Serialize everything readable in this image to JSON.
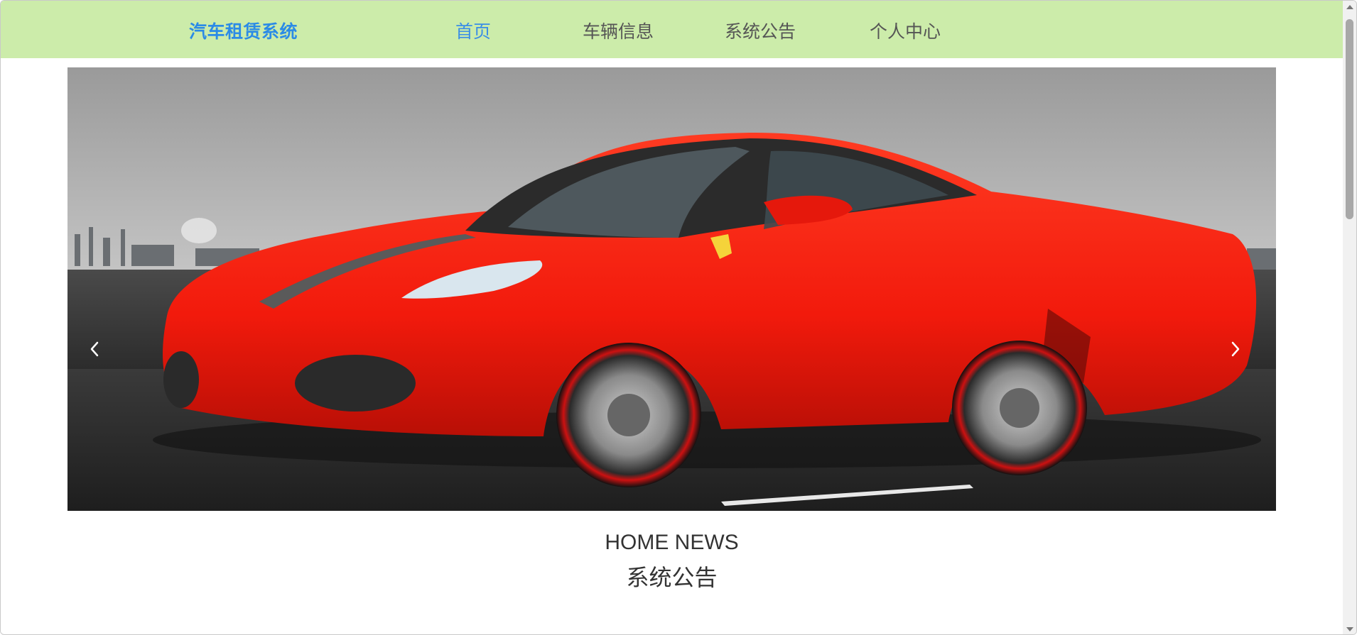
{
  "header": {
    "brand": "汽车租赁系统",
    "nav": [
      {
        "label": "首页",
        "active": true
      },
      {
        "label": "车辆信息",
        "active": false
      },
      {
        "label": "系统公告",
        "active": false
      },
      {
        "label": "个人中心",
        "active": false
      }
    ]
  },
  "carousel": {
    "slide_count": 3,
    "active_index": 0,
    "prev_icon": "chevron-left-icon",
    "next_icon": "chevron-right-icon"
  },
  "section": {
    "title_en": "HOME NEWS",
    "title_zh": "系统公告"
  },
  "colors": {
    "nav_bg": "#ccecaa",
    "brand": "#2b8be6",
    "nav_active": "#3a8ee6",
    "dot_active": "#f7941d"
  }
}
